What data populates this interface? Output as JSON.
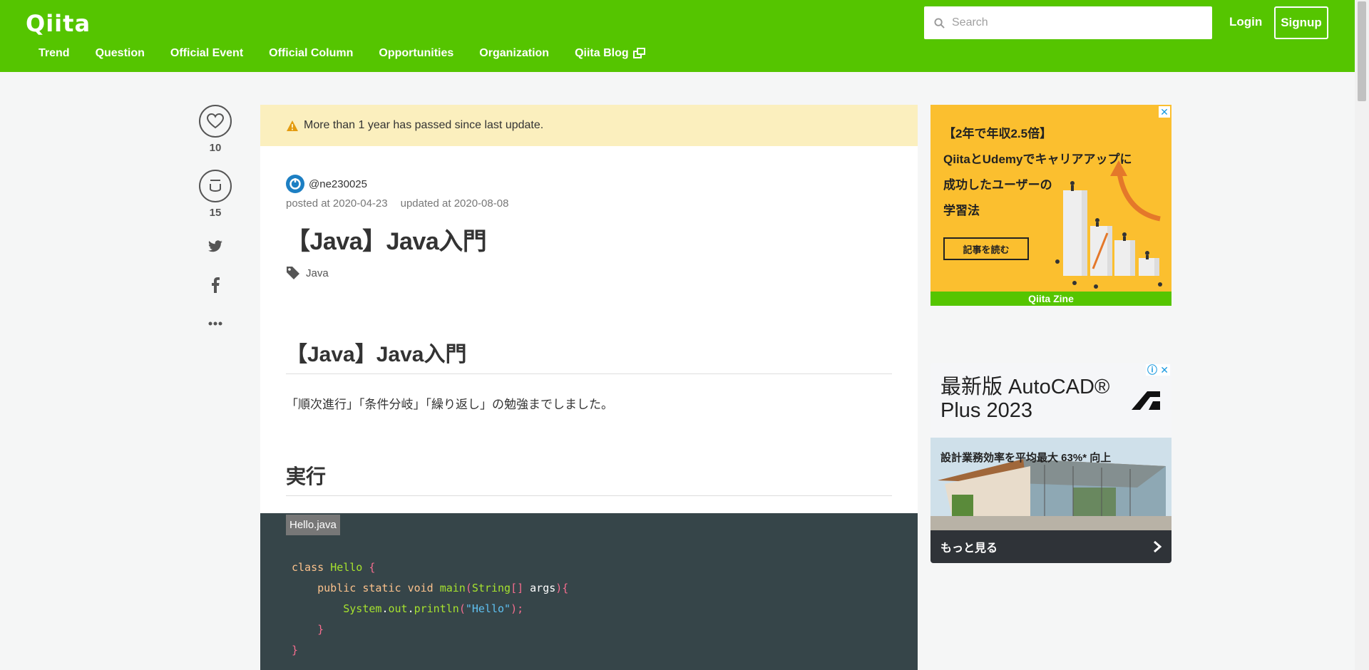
{
  "header": {
    "logo": "Qiita",
    "search_placeholder": "Search",
    "login_label": "Login",
    "signup_label": "Signup",
    "nav": [
      "Trend",
      "Question",
      "Official Event",
      "Official Column",
      "Opportunities",
      "Organization",
      "Qiita Blog"
    ]
  },
  "actions": {
    "like_count": "10",
    "stock_count": "15"
  },
  "article": {
    "notice": "More than 1 year has passed since last update.",
    "author": "@ne230025",
    "posted": "posted at 2020-04-23",
    "updated": "updated at 2020-08-08",
    "title": "【Java】Java入門",
    "tag": "Java",
    "h1": "【Java】Java入門",
    "paragraph": "「順次進行」「条件分岐」「繰り返し」の勉強までしました。",
    "h2": "実行",
    "code_filename": "Hello.java"
  },
  "ads": {
    "ad1_line1": "【2年で年収2.5倍】",
    "ad1_line2": "QiitaとUdemyでキャリアアップに",
    "ad1_line3": "成功したユーザーの",
    "ad1_line4": "学習法",
    "ad1_button": "記事を読む",
    "ad1_footer": "Qiita Zine",
    "ad2_title_line1": "最新版 AutoCAD®",
    "ad2_title_line2": "Plus 2023",
    "ad2_sub": "設計業務効率を平均最大 63%* 向上",
    "ad2_more": "もっと見る"
  },
  "colors": {
    "brand": "#55c500",
    "notice_bg": "#fbefbe",
    "code_bg": "#364549"
  }
}
